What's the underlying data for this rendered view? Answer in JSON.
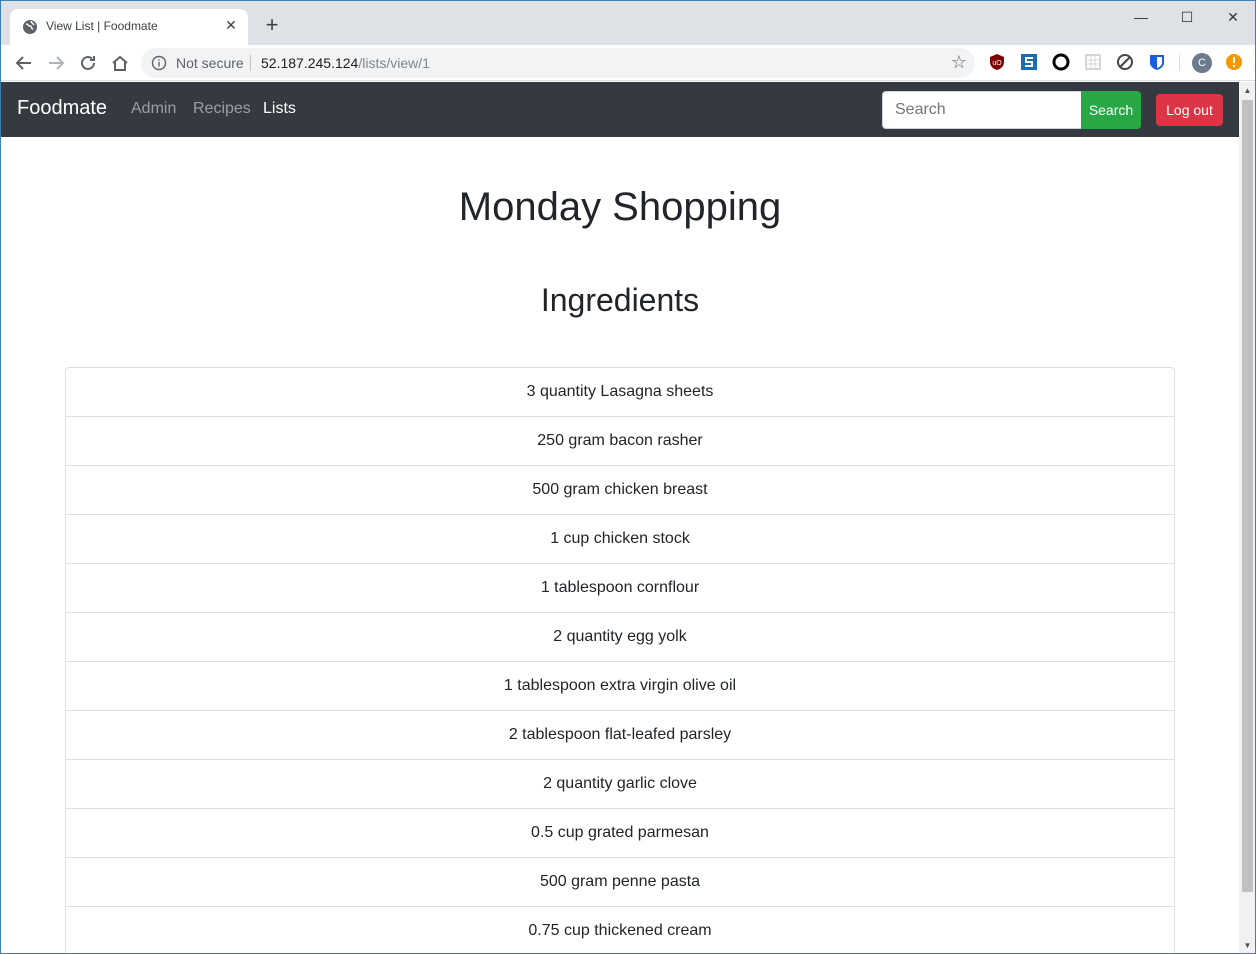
{
  "browser": {
    "tab_title": "View List | Foodmate",
    "new_tab": "+",
    "not_secure": "Not secure",
    "url_host": "52.187.245.124",
    "url_path": "/lists/view/1",
    "profile_initial": "C"
  },
  "navbar": {
    "brand": "Foodmate",
    "links": [
      "Admin",
      "Recipes",
      "Lists"
    ],
    "active_link": "Lists",
    "search_placeholder": "Search",
    "search_button": "Search",
    "logout_button": "Log out",
    "colors": {
      "background": "#343a40",
      "search": "#28a745",
      "logout": "#dc3545"
    }
  },
  "main": {
    "title": "Monday Shopping",
    "section_heading": "Ingredients",
    "ingredients": [
      "3 quantity Lasagna sheets",
      "250 gram bacon rasher",
      "500 gram chicken breast",
      "1 cup chicken stock",
      "1 tablespoon cornflour",
      "2 quantity egg yolk",
      "1 tablespoon extra virgin olive oil",
      "2 tablespoon flat-leafed parsley",
      "2 quantity garlic clove",
      "0.5 cup grated parmesan",
      "500 gram penne pasta",
      "0.75 cup thickened cream"
    ]
  }
}
